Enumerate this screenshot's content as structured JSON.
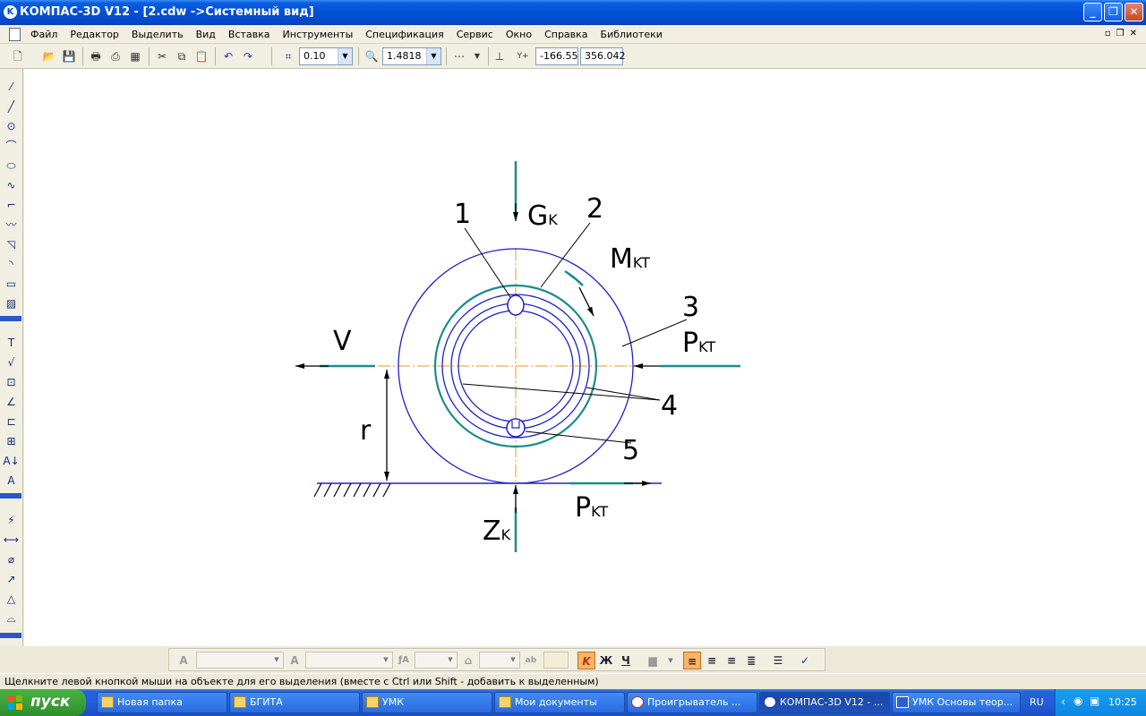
{
  "window": {
    "title": "КОМПАС-3D V12 - [2.cdw ->Системный вид]",
    "app_icon_letter": "K"
  },
  "menu": {
    "items": [
      "Файл",
      "Редактор",
      "Выделить",
      "Вид",
      "Вставка",
      "Инструменты",
      "Спецификация",
      "Сервис",
      "Окно",
      "Справка",
      "Библиотеки"
    ]
  },
  "toolbar": {
    "step_value": "0.10",
    "zoom_value": "1.4818",
    "coord_x": "-166.55",
    "coord_y": "356.042"
  },
  "drawing": {
    "labels": {
      "n1": "1",
      "n2": "2",
      "n3": "3",
      "n4": "4",
      "n5": "5",
      "gk_main": "G",
      "gk_sub": "K",
      "mkt_main": "M",
      "mkt_sub": "KT",
      "pkt_main": "P",
      "pkt_sub": "KT",
      "pkt2_main": "P",
      "pkt2_sub": "KT",
      "zk_main": "Z",
      "zk_sub": "K",
      "v": "V",
      "r": "r"
    },
    "colors": {
      "outline": "#2020c8",
      "teal": "#1a8c8c",
      "axis": "#e89a20",
      "arrows": "#000000"
    }
  },
  "status": {
    "hint": "Щелкните левой кнопкой мыши на объекте для его выделения (вместе с Ctrl или Shift - добавить к выделенным)"
  },
  "taskbar": {
    "start_label": "пуск",
    "items": [
      "Новая папка",
      "БГИТА",
      "УМК",
      "Мои документы",
      "Проигрыватель ...",
      "КОМПАС-3D V12 - ...",
      "УМК Основы теор..."
    ],
    "lang": "RU",
    "clock": "10:25"
  }
}
